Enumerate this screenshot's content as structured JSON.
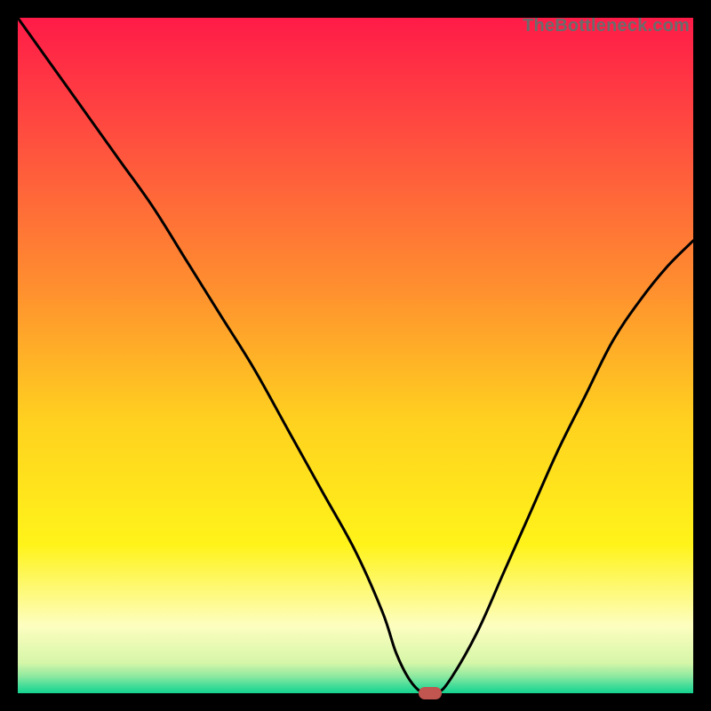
{
  "watermark": "TheBottleneck.com",
  "colors": {
    "frame": "#000000",
    "marker": "#c1554f",
    "curve_stroke": "#000000",
    "gradient_stops": [
      {
        "offset": 0.0,
        "color": "#ff1b48"
      },
      {
        "offset": 0.18,
        "color": "#ff4f3f"
      },
      {
        "offset": 0.4,
        "color": "#ff8f2f"
      },
      {
        "offset": 0.6,
        "color": "#ffd21f"
      },
      {
        "offset": 0.78,
        "color": "#fff31a"
      },
      {
        "offset": 0.9,
        "color": "#fdfec0"
      },
      {
        "offset": 0.955,
        "color": "#d6f6a8"
      },
      {
        "offset": 0.975,
        "color": "#8de9a0"
      },
      {
        "offset": 0.99,
        "color": "#3fdc98"
      },
      {
        "offset": 1.0,
        "color": "#14d38f"
      }
    ]
  },
  "chart_data": {
    "type": "line",
    "title": "",
    "xlabel": "",
    "ylabel": "",
    "xlim": [
      0,
      100
    ],
    "ylim": [
      0,
      100
    ],
    "series": [
      {
        "name": "bottleneck-curve",
        "x": [
          0,
          5,
          10,
          15,
          20,
          25,
          30,
          35,
          40,
          45,
          50,
          54,
          56,
          58,
          60,
          62,
          64,
          68,
          72,
          76,
          80,
          84,
          88,
          92,
          96,
          100
        ],
        "y": [
          100,
          93,
          86,
          79,
          72,
          64,
          56,
          48,
          39,
          30,
          21,
          12,
          6,
          2,
          0,
          0,
          2,
          9,
          18,
          27,
          36,
          44,
          52,
          58,
          63,
          67
        ]
      }
    ],
    "marker": {
      "x": 61,
      "y": 0
    }
  }
}
